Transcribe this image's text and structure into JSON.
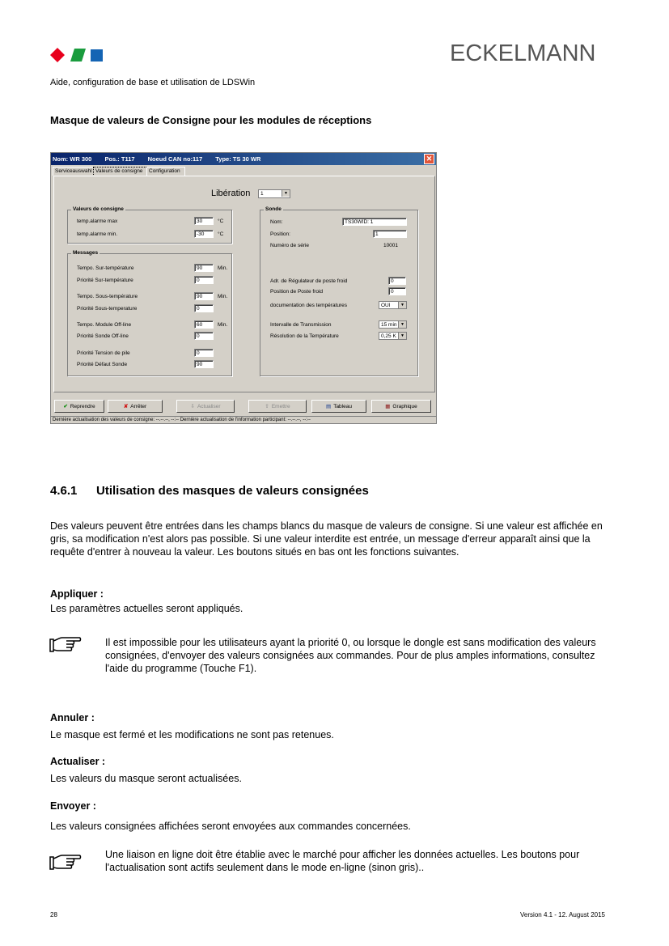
{
  "header": {
    "brand": "ECKELMANN",
    "subtitle": "Aide, configuration de base et utilisation de LDSWin",
    "logo_colors": [
      "#e8001c",
      "#1a9c3e",
      "#1464b4"
    ]
  },
  "section_heading": "Masque de valeurs de Consigne pour les modules de réceptions",
  "window": {
    "title": {
      "nom": "Nom: WR 300",
      "pos": "Pos.: T117",
      "noeud": "Noeud CAN no:117",
      "type": "Type: TS 30 WR"
    },
    "close": "✕",
    "tabs": [
      "Serviceauswahl",
      "Valeurs de consigne",
      "Configuration"
    ],
    "liberation_label": "Libération",
    "liberation_value": "1",
    "valeurs": {
      "title": "Valeurs de consigne",
      "rows": [
        {
          "label": "temp.alarme max",
          "value": "30",
          "unit": "°C"
        },
        {
          "label": "temp.alarme min.",
          "value": "-30",
          "unit": "°C"
        }
      ]
    },
    "messages": {
      "title": "Messages",
      "rows": [
        {
          "label": "Tempo. Sur-température",
          "value": "90",
          "unit": "Min."
        },
        {
          "label": "Priorité Sur-température",
          "value": "0",
          "unit": ""
        },
        {
          "label": "Tempo. Sous-température",
          "value": "90",
          "unit": "Min."
        },
        {
          "label": "Priorité Sous-temperature",
          "value": "0",
          "unit": ""
        },
        {
          "label": "Tempo. Module Off-line",
          "value": "60",
          "unit": "Min."
        },
        {
          "label": "Priorité Sonde Off-line",
          "value": "0",
          "unit": ""
        },
        {
          "label": "Priorité Tension de pile",
          "value": "0",
          "unit": ""
        },
        {
          "label": "Priorité Défaut Sonde",
          "value": "90",
          "unit": ""
        }
      ]
    },
    "sonde": {
      "title": "Sonde",
      "nom_label": "Nom:",
      "nom_value": "TS30WID: 1",
      "position_label": "Position:",
      "position_value": "1",
      "serie_label": "Numéro de série",
      "serie_value": "10001",
      "adr_label": "Adr. de Régulateur de poste froid",
      "adr_value": "0",
      "posfroid_label": "Position de Poste froid",
      "posfroid_value": "0",
      "doc_label": "documentation des températures",
      "doc_value": "OUI",
      "intervalle_label": "Intervalle de Transmission",
      "intervalle_value": "15 min",
      "resolution_label": "Résolution de la Température",
      "resolution_value": "0,25 K"
    },
    "buttons": {
      "reprendre": "Reprendre",
      "arreter": "Arrêter",
      "actualiser": "Actualiser",
      "emettre": "Emettre",
      "tableau": "Tableau",
      "graphique": "Graphique"
    },
    "status": "Dernière actualisation des valeurs de consigne: --.--.--, --:-- Dernière actualisation de l'information participant: --.--.--, --:--"
  },
  "section": {
    "number": "4.6.1",
    "title": "Utilisation des masques de valeurs consignées",
    "intro": "Des valeurs peuvent être entrées dans les champs blancs du masque de valeurs de consigne. Si une valeur est affichée en gris, sa modification n'est alors pas possible. Si une valeur interdite est entrée, un message d'erreur apparaît ainsi que la requête d'entrer à nouveau la valeur. Les boutons situés en bas ont les fonctions suivantes."
  },
  "items": [
    {
      "title": "Appliquer :",
      "text": "Les paramètres actuelles seront appliqués."
    },
    {
      "title": "Annuler :",
      "text": "Le masque est fermé et les modifications ne sont pas retenues."
    },
    {
      "title": "Actualiser :",
      "text": "Les valeurs du masque seront actualisées."
    },
    {
      "title": "Envoyer :",
      "text": "Les valeurs consignées affichées seront envoyées aux commandes concernées."
    }
  ],
  "notes": [
    "Il est impossible pour les utilisateurs ayant la priorité 0, ou lorsque le dongle est sans modification des valeurs consignées, d'envoyer des valeurs consignées aux commandes. Pour de plus amples informations, consultez l'aide du programme (Touche F1).",
    "Une liaison en ligne doit être établie avec le marché pour afficher les données actuelles. Les boutons pour l'actualisation sont actifs seulement dans le mode en-ligne  (sinon gris).."
  ],
  "footer": {
    "page": "28",
    "version": "Version 4.1 -  12. August 2015"
  }
}
